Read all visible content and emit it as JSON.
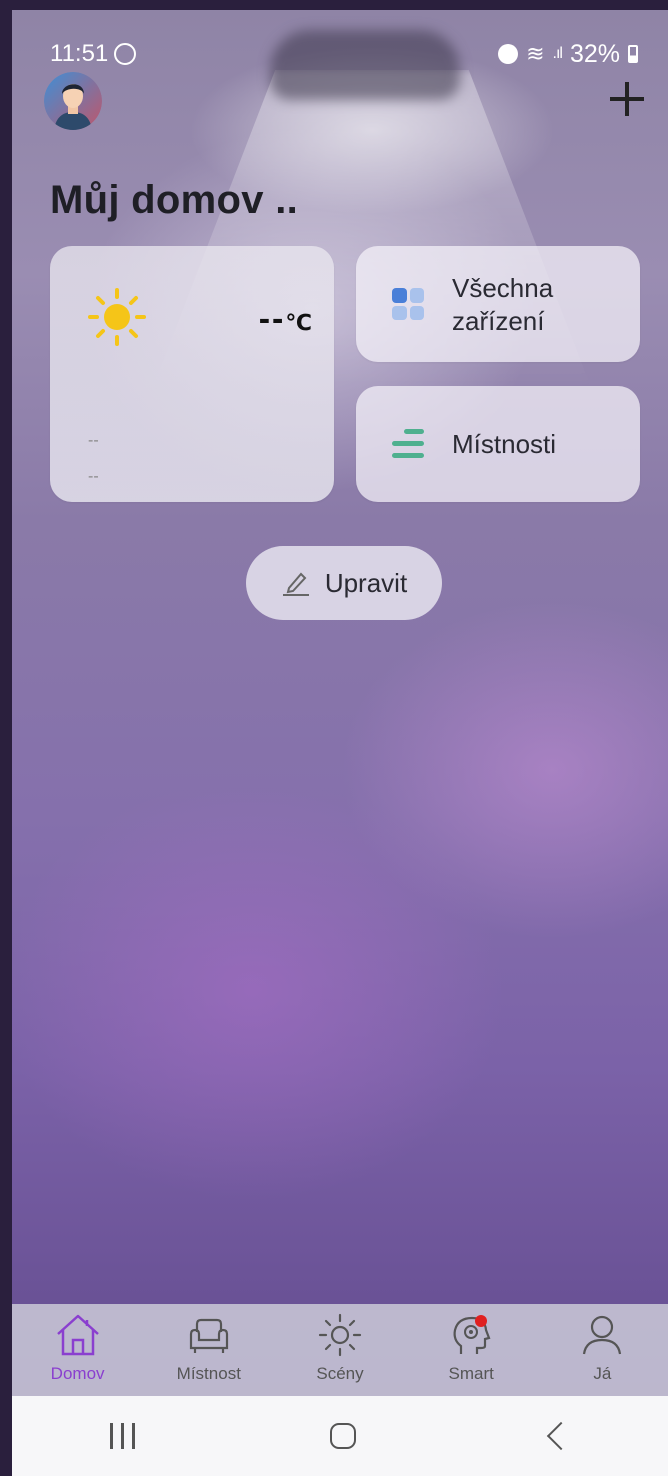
{
  "status_bar": {
    "time": "11:51",
    "battery": "32%",
    "icons": [
      "whatsapp-icon",
      "alarm-icon",
      "wifi-icon",
      "signal-icon",
      "battery-icon"
    ]
  },
  "header": {
    "avatar_icon": "user-avatar",
    "add_icon": "plus-icon"
  },
  "home": {
    "title": "Můj domov .."
  },
  "weather": {
    "icon": "sun-icon",
    "temperature": "--",
    "unit": "℃",
    "line1": "--",
    "line2": "--"
  },
  "shortcuts": {
    "devices_line1": "Všechna",
    "devices_line2": "zařízení",
    "rooms": "Místnosti"
  },
  "edit_button": {
    "label": "Upravit"
  },
  "tabbar": {
    "items": [
      {
        "label": "Domov",
        "icon": "house-icon",
        "active": true
      },
      {
        "label": "Místnost",
        "icon": "armchair-icon",
        "active": false
      },
      {
        "label": "Scény",
        "icon": "sun-icon",
        "active": false
      },
      {
        "label": "Smart",
        "icon": "brain-head-icon",
        "active": false
      },
      {
        "label": "Já",
        "icon": "person-icon",
        "active": false
      }
    ]
  },
  "colors": {
    "accent": "#8a3fcf",
    "rooms_icon": "#4fb08f",
    "devices_icon": "#4a7fd8",
    "sun": "#f5c518",
    "notification_dot": "#e02020"
  }
}
